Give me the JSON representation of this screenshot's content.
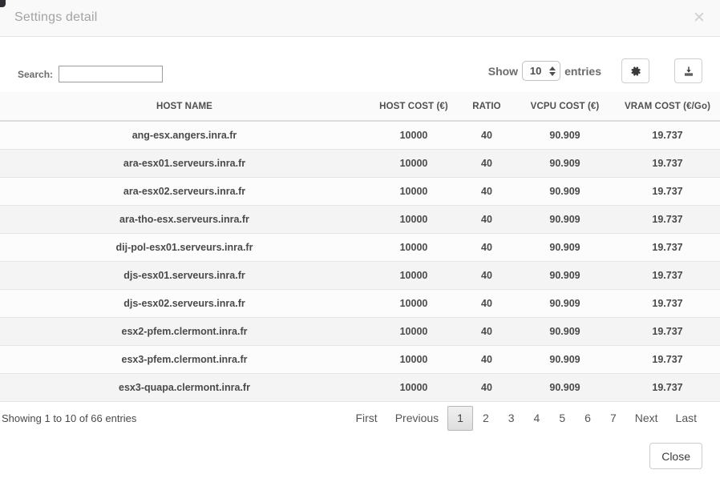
{
  "dialog": {
    "title": "Settings detail",
    "close_icon": "close-x-icon",
    "close_button_label": "Close"
  },
  "toolbar": {
    "search_label": "Search:",
    "search_value": "",
    "search_placeholder": "",
    "show_label": "Show",
    "entries_label": "entries",
    "page_length": "10",
    "settings_icon": "gear-icon",
    "export_icon": "download-icon"
  },
  "table": {
    "columns": [
      "HOST NAME",
      "HOST COST (€)",
      "RATIO",
      "VCPU COST (€)",
      "VRAM COST (€/Go)"
    ],
    "rows": [
      {
        "host": "ang-esx.angers.inra.fr",
        "host_cost": "10000",
        "ratio": "40",
        "vcpu_cost": "90.909",
        "vram_cost": "19.737"
      },
      {
        "host": "ara-esx01.serveurs.inra.fr",
        "host_cost": "10000",
        "ratio": "40",
        "vcpu_cost": "90.909",
        "vram_cost": "19.737"
      },
      {
        "host": "ara-esx02.serveurs.inra.fr",
        "host_cost": "10000",
        "ratio": "40",
        "vcpu_cost": "90.909",
        "vram_cost": "19.737"
      },
      {
        "host": "ara-tho-esx.serveurs.inra.fr",
        "host_cost": "10000",
        "ratio": "40",
        "vcpu_cost": "90.909",
        "vram_cost": "19.737"
      },
      {
        "host": "dij-pol-esx01.serveurs.inra.fr",
        "host_cost": "10000",
        "ratio": "40",
        "vcpu_cost": "90.909",
        "vram_cost": "19.737"
      },
      {
        "host": "djs-esx01.serveurs.inra.fr",
        "host_cost": "10000",
        "ratio": "40",
        "vcpu_cost": "90.909",
        "vram_cost": "19.737"
      },
      {
        "host": "djs-esx02.serveurs.inra.fr",
        "host_cost": "10000",
        "ratio": "40",
        "vcpu_cost": "90.909",
        "vram_cost": "19.737"
      },
      {
        "host": "esx2-pfem.clermont.inra.fr",
        "host_cost": "10000",
        "ratio": "40",
        "vcpu_cost": "90.909",
        "vram_cost": "19.737"
      },
      {
        "host": "esx3-pfem.clermont.inra.fr",
        "host_cost": "10000",
        "ratio": "40",
        "vcpu_cost": "90.909",
        "vram_cost": "19.737"
      },
      {
        "host": "esx3-quapa.clermont.inra.fr",
        "host_cost": "10000",
        "ratio": "40",
        "vcpu_cost": "90.909",
        "vram_cost": "19.737"
      }
    ]
  },
  "footer": {
    "info": "Showing 1 to 10 of 66 entries",
    "pagination": {
      "first": "First",
      "previous": "Previous",
      "pages": [
        "1",
        "2",
        "3",
        "4",
        "5",
        "6",
        "7"
      ],
      "active_page": "1",
      "next": "Next",
      "last": "Last"
    }
  },
  "colors": {
    "header_bg": "#f9f9f9",
    "title_text": "#a3a3a3",
    "row_odd": "#fcfcfc",
    "row_even": "#f4f4f4",
    "text": "#4a4a4a"
  }
}
